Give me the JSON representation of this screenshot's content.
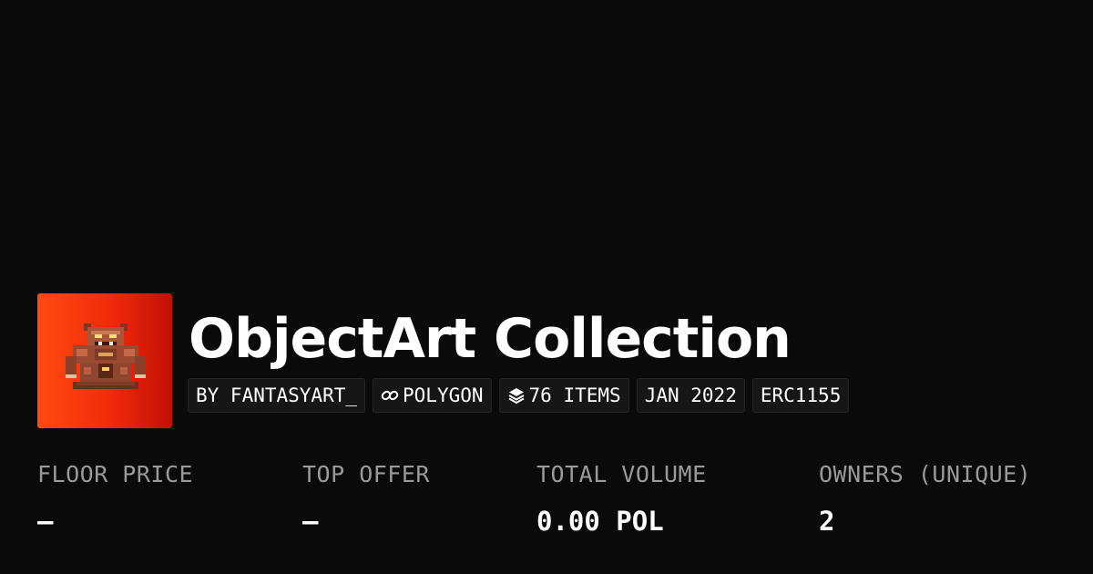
{
  "collection": {
    "title": "ObjectArt Collection",
    "thumbnail_icon": "pixel-ogre-statue-icon",
    "thumbnail_gradient": [
      "#ff4a10",
      "#c20f06"
    ]
  },
  "tags": {
    "creator": "BY FANTASYART_",
    "chain": "POLYGON",
    "chain_icon": "chain-link-icon",
    "items": "76 ITEMS",
    "items_icon": "layers-icon",
    "date": "JAN 2022",
    "standard": "ERC1155"
  },
  "stats": {
    "floor_price": {
      "label": "FLOOR PRICE",
      "value": "–"
    },
    "top_offer": {
      "label": "TOP OFFER",
      "value": "–"
    },
    "total_volume": {
      "label": "TOTAL VOLUME",
      "value": "0.00 POL"
    },
    "owners": {
      "label": "OWNERS (UNIQUE)",
      "value": "2"
    }
  },
  "colors": {
    "background": "#0a0a0a",
    "label_gray": "#9a9a9a",
    "tag_bg": "#161616"
  }
}
